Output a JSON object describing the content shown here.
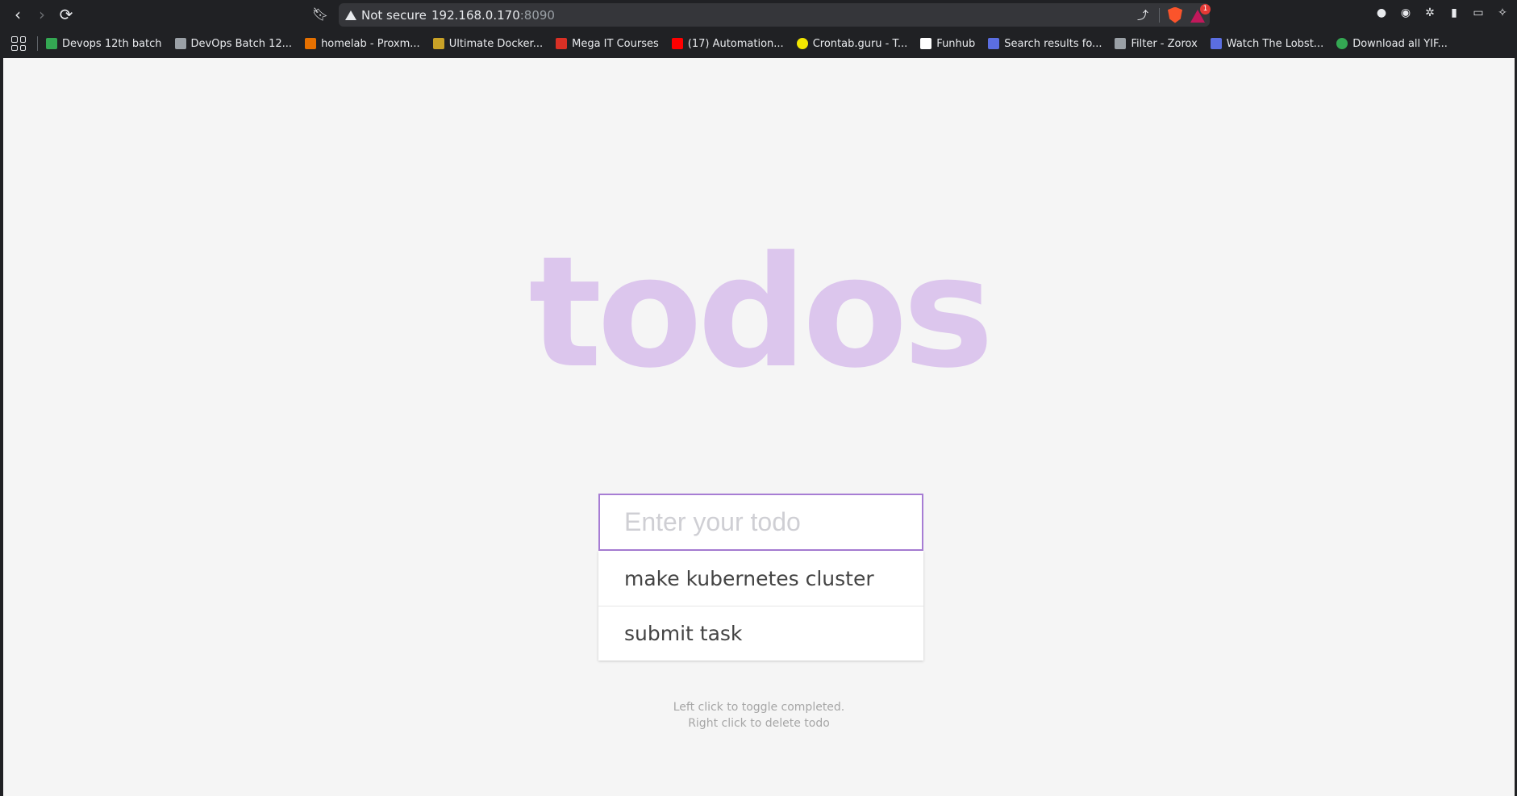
{
  "browser": {
    "security_label": "Not secure",
    "url_host": "192.168.0.170",
    "url_port": ":8090",
    "rewards_badge": "1"
  },
  "bookmarks": [
    {
      "label": "Devops 12th batch",
      "color": "#34a853"
    },
    {
      "label": "DevOps Batch 12...",
      "color": "#9aa0a6"
    },
    {
      "label": "homelab - Proxm...",
      "color": "#e57000"
    },
    {
      "label": "Ultimate Docker...",
      "color": "#c9a227"
    },
    {
      "label": "Mega IT Courses",
      "color": "#d93025"
    },
    {
      "label": "(17) Automation...",
      "color": "#ff0000"
    },
    {
      "label": "Crontab.guru - T...",
      "color": "#f2e600"
    },
    {
      "label": "Funhub",
      "color": "#ffffff"
    },
    {
      "label": "Search results fo...",
      "color": "#5b6ee1"
    },
    {
      "label": "Filter - Zorox",
      "color": "#9aa0a6"
    },
    {
      "label": "Watch The Lobst...",
      "color": "#5b6ee1"
    },
    {
      "label": "Download all YIF...",
      "color": "#34a853"
    }
  ],
  "app": {
    "title": "todos",
    "input_placeholder": "Enter your todo",
    "todos": [
      {
        "text": "make kubernetes cluster"
      },
      {
        "text": "submit task"
      }
    ],
    "hint_line1": "Left click to toggle completed.",
    "hint_line2": "Right click to delete todo"
  },
  "colors": {
    "title": "#dcc6ed",
    "input_border": "#a77dd4",
    "page_bg": "#f5f5f5"
  }
}
